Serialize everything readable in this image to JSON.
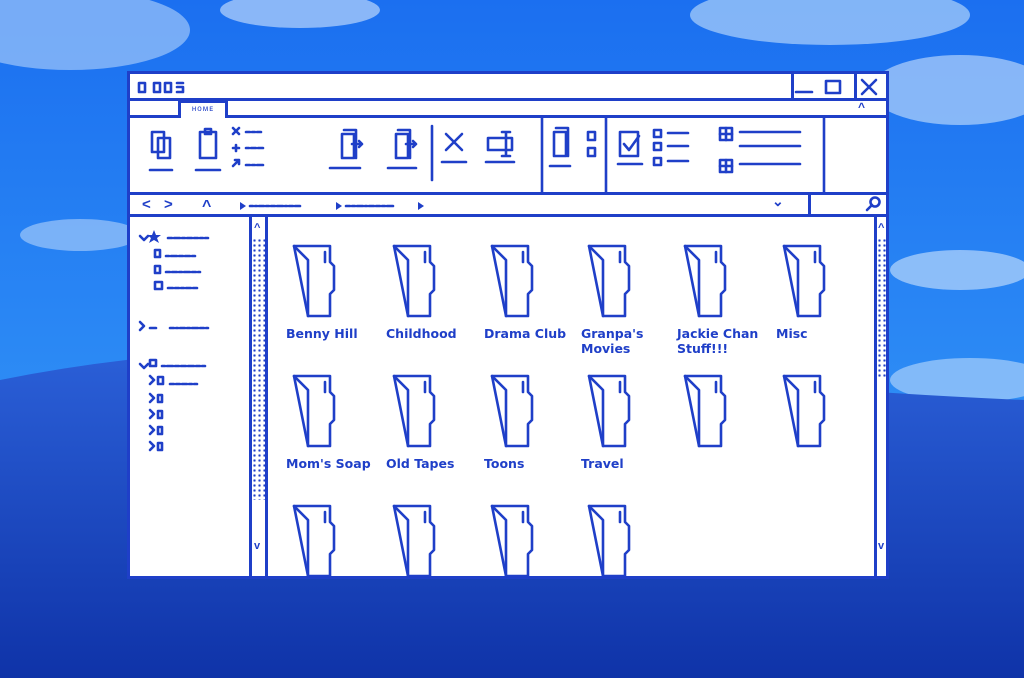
{
  "window": {
    "title_controls": {
      "minimize": "—",
      "maximize": "□",
      "close": "✕"
    },
    "tab_label": "ʜᴏᴍᴇ",
    "collapse_ribbon": "^"
  },
  "nav": {
    "back": "<",
    "forward": ">",
    "up": "^",
    "dropdown": "⌄"
  },
  "folders": [
    {
      "name": "Benny Hill"
    },
    {
      "name": "Childhood"
    },
    {
      "name": "Drama Club"
    },
    {
      "name": "Granpa's Movies"
    },
    {
      "name": "Jackie Chan Stuff!!!"
    },
    {
      "name": "Misc"
    },
    {
      "name": "Mom's Soap"
    },
    {
      "name": "Old Tapes"
    },
    {
      "name": "Toons"
    },
    {
      "name": "Travel"
    },
    {
      "name": ""
    },
    {
      "name": ""
    },
    {
      "name": ""
    },
    {
      "name": ""
    },
    {
      "name": ""
    },
    {
      "name": ""
    }
  ],
  "colors": {
    "ink": "#1f3fc8",
    "sky": "#1a5fe0",
    "window": "#ffffff"
  },
  "icons": [
    "copy-icon",
    "paste-icon",
    "cut-icon",
    "move-icon",
    "copy-to-icon",
    "delete-icon",
    "rename-icon",
    "new-folder-icon",
    "properties-icon",
    "select-icon",
    "grid-view-icon",
    "search-icon",
    "star-icon"
  ]
}
